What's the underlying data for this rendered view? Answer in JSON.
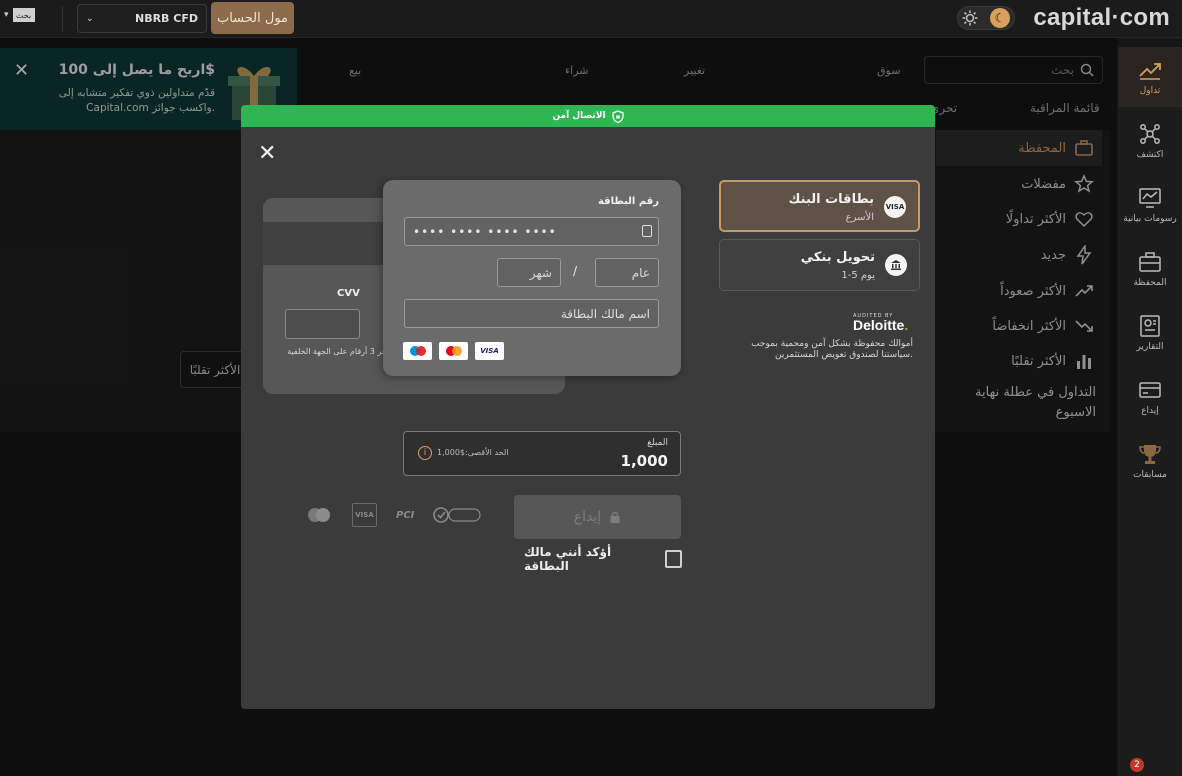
{
  "topbar": {
    "lang_label": "بحث",
    "account_select": "NBRB CFD",
    "fund_button": "مول الحساب",
    "logo": "capital·com"
  },
  "sidebar": {
    "items": [
      {
        "label": "تداول",
        "icon": "trend-icon"
      },
      {
        "label": "اكتشف",
        "icon": "network-icon"
      },
      {
        "label": "رسومات بيانية",
        "icon": "chart-monitor-icon"
      },
      {
        "label": "المحفظة",
        "icon": "briefcase-icon"
      },
      {
        "label": "التقارير",
        "icon": "report-icon"
      },
      {
        "label": "إيداع",
        "icon": "deposit-icon"
      },
      {
        "label": "مسابقات",
        "icon": "trophy-icon"
      }
    ],
    "settings_badge": "2"
  },
  "markets": {
    "search_placeholder": "بحث",
    "columns": [
      "سوق",
      "تغيير",
      "شراء",
      "بيع"
    ],
    "tabs": [
      "قائمة المراقبة",
      "تحري"
    ],
    "list": [
      {
        "label": "المحفظة",
        "icon": "briefcase-icon"
      },
      {
        "label": "مفضلات",
        "icon": "star-icon"
      },
      {
        "label": "الأكثر تداولًا",
        "icon": "heart-icon"
      },
      {
        "label": "جديد",
        "icon": "bolt-icon"
      },
      {
        "label": "الأكثر صعوداً",
        "icon": "trend-up-icon"
      },
      {
        "label": "الأكثر انخفاضاً",
        "icon": "trend-down-icon"
      },
      {
        "label": "الأكثر تقلبًا",
        "icon": "bar-chart-icon"
      }
    ],
    "weekend": "التداول في عطلة نهاية الاسبوع",
    "ghost_button": "الأكثر تقلبًا"
  },
  "promo": {
    "title": "اربح ما يصل إلى 100$",
    "text": "قدّم متداولين ذوي تفكير متشابه إلى Capital.com واكسب جوائز."
  },
  "modal": {
    "secure_label": "الاتصال آمن",
    "methods": [
      {
        "title": "بطاقات البنك",
        "subtitle": "الأسرع",
        "icon": "VISA",
        "selected": true
      },
      {
        "title": "تحويل بنكي",
        "subtitle": "1-5 يوم",
        "icon": "bank-icon",
        "selected": false
      }
    ],
    "audited_by": "AUDITED BY",
    "deloitte": "Deloitte",
    "deloitte_note": "أموالك محفوظة بشكل آمن ومحمية بموجب سياستنا لصندوق تعويض المستثمرين.",
    "card": {
      "number_label": "رقم البطاقة",
      "number_value": "•••• •••• •••• ••••",
      "year_placeholder": "عام",
      "month_placeholder": "شهر",
      "slash": "/",
      "name_placeholder": "اسم مالك البطاقة",
      "cvv_label": "CVV",
      "cvv_help": "آخر 3 أرقام على الجهة الخلفية",
      "brands": [
        "VISA",
        "Mastercard",
        "Maestro"
      ]
    },
    "amount": {
      "label": "المبلغ",
      "value": "1,000",
      "max": "الحد الأقصى:$1,000"
    },
    "deposit_button": "إيداع",
    "confirm_label": "أؤكد أنني مالك البطاقة",
    "trust_logos": [
      "Norton",
      "PCI DSS",
      "VISA",
      "Mastercard"
    ]
  }
}
